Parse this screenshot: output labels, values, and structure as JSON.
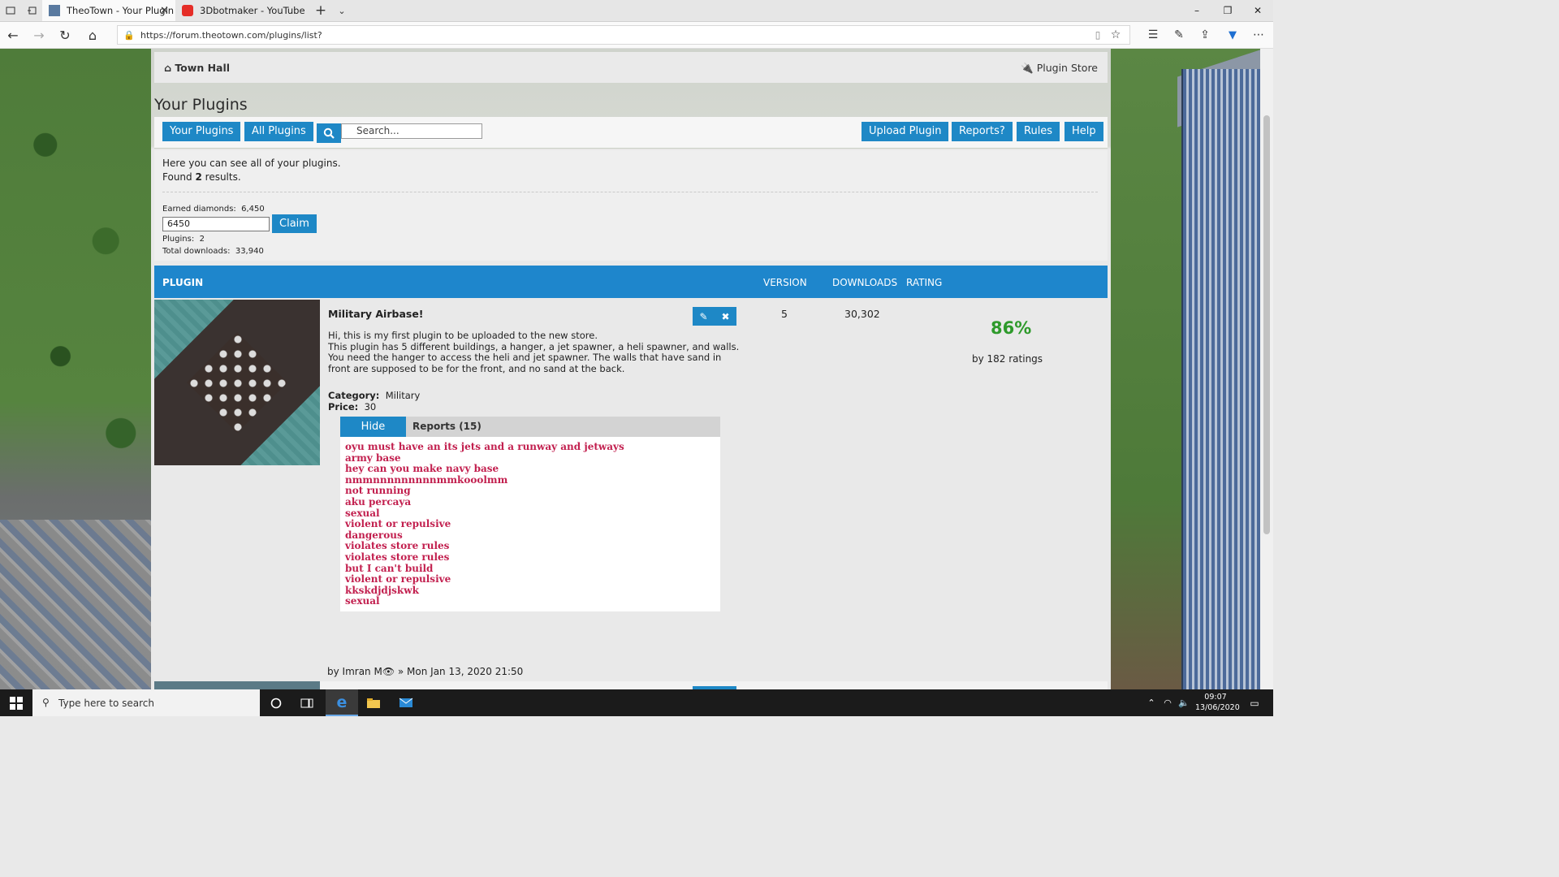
{
  "browser": {
    "tabs": [
      {
        "title": "TheoTown - Your Plugin",
        "active": true
      },
      {
        "title": "3Dbotmaker - YouTube",
        "active": false
      }
    ],
    "url": "https://forum.theotown.com/plugins/list?",
    "window_controls": [
      "–",
      "❐",
      "✕"
    ]
  },
  "forum": {
    "nav_home": "Town Hall",
    "nav_store": "Plugin Store",
    "page_title": "Your Plugins",
    "toolbar": {
      "your_plugins": "Your Plugins",
      "all_plugins": "All Plugins",
      "search_placeholder": "Search...",
      "upload": "Upload Plugin",
      "reports": "Reports?",
      "rules": "Rules",
      "help": "Help"
    },
    "info": {
      "line1": "Here you can see all of your plugins.",
      "found_prefix": "Found ",
      "found_count": "2",
      "found_suffix": " results.",
      "earned_label": "Earned diamonds:",
      "earned_value": "6,450",
      "claim_input_value": "6450",
      "claim_label": "Claim",
      "plugins_label": "Plugins:",
      "plugins_value": "2",
      "downloads_label": "Total downloads:",
      "downloads_value": "33,940"
    },
    "table_headers": {
      "plugin": "PLUGIN",
      "version": "VERSION",
      "downloads": "DOWNLOADS",
      "rating": "RATING"
    },
    "plugin": {
      "title": "Military Airbase!",
      "description": [
        "Hi, this is my first plugin to be uploaded to the new store.",
        "This plugin has 5 different buildings, a hanger, a jet spawner, a heli spawner, and walls.",
        "You need the hanger to access the heli and jet spawner. The walls that have sand in",
        "front are supposed to be for the front, and no sand at the back."
      ],
      "category_label": "Category:",
      "category": "Military",
      "price_label": "Price:",
      "price": "30",
      "version": "5",
      "downloads": "30,302",
      "rating_percent": "86%",
      "rating_count": "by 182 ratings",
      "hide_label": "Hide",
      "reports_label": "Reports (15)",
      "reports": [
        "oyu must have an its jets and a runway and jetways",
        "army base",
        "hey can you make navy base",
        "nmmnnnnnnnnnmmkooolmm",
        "not running",
        "aku percaya",
        "sexual",
        "violent or repulsive",
        "dangerous",
        "violates store rules",
        "violates store rules",
        "but I can't build",
        "violent or repulsive",
        "kkskdjdjskwk",
        "sexual"
      ],
      "author": "by Imran M",
      "date": " » Mon Jan 13, 2020 21:50"
    }
  },
  "taskbar": {
    "search_placeholder": "Type here to search",
    "time": "09:07",
    "date": "13/06/2020"
  },
  "colors": {
    "accent": "#1e88c6",
    "header": "#1e86cc",
    "report_text": "#c21f4e",
    "rating": "#2e9a2b"
  }
}
